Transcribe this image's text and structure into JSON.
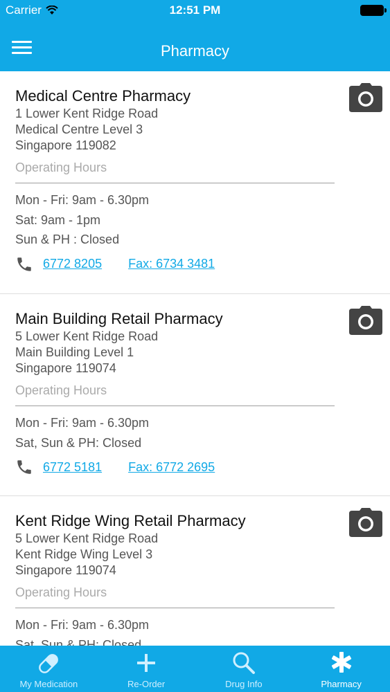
{
  "status_bar": {
    "carrier": "Carrier",
    "time": "12:51 PM"
  },
  "header": {
    "title": "Pharmacy"
  },
  "colors": {
    "accent": "#11a9e6",
    "link": "#11a9e6"
  },
  "pharmacies": [
    {
      "name": "Medical Centre Pharmacy",
      "address": [
        "1 Lower Kent Ridge Road",
        "Medical Centre Level 3",
        "Singapore 119082"
      ],
      "hours_title": "Operating Hours",
      "hours": [
        "Mon - Fri: 9am - 6.30pm",
        "Sat: 9am - 1pm",
        "Sun & PH : Closed"
      ],
      "phone": "6772 8205",
      "fax": "Fax: 6734 3481"
    },
    {
      "name": "Main Building Retail Pharmacy",
      "address": [
        "5 Lower Kent Ridge Road",
        "Main Building Level 1",
        "Singapore 119074"
      ],
      "hours_title": "Operating Hours",
      "hours": [
        "Mon - Fri: 9am - 6.30pm",
        "Sat, Sun & PH: Closed"
      ],
      "phone": "6772 5181",
      "fax": "Fax: 6772 2695"
    },
    {
      "name": "Kent Ridge Wing Retail Pharmacy",
      "address": [
        "5 Lower Kent Ridge Road",
        "Kent Ridge Wing Level 3",
        "Singapore 119074"
      ],
      "hours_title": "Operating Hours",
      "hours": [
        "Mon - Fri: 9am - 6.30pm",
        "Sat, Sun & PH: Closed"
      ]
    }
  ],
  "tabs": [
    {
      "label": "My Medication",
      "icon": "pill-icon"
    },
    {
      "label": "Re-Order",
      "icon": "plus-icon"
    },
    {
      "label": "Drug Info",
      "icon": "search-icon"
    },
    {
      "label": "Pharmacy",
      "icon": "asterisk-icon",
      "active": true
    }
  ]
}
